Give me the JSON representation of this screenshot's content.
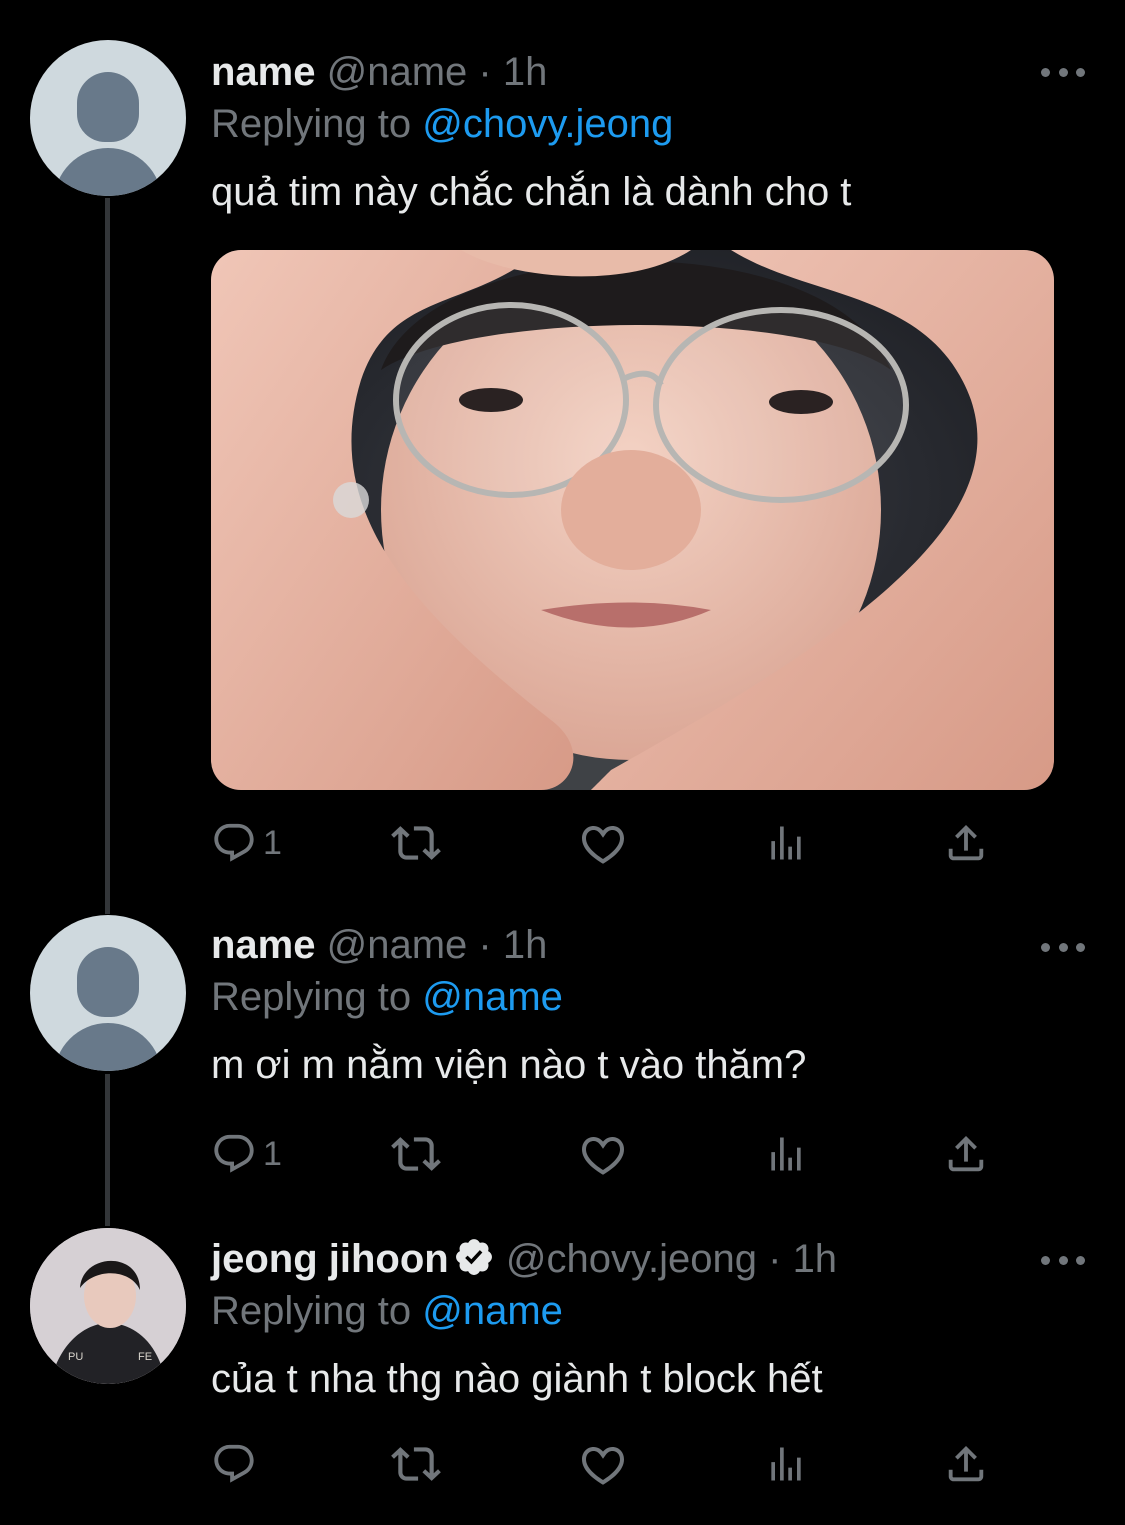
{
  "tweets": [
    {
      "display_name": "name",
      "handle": "@name",
      "separator": "·",
      "time": "1h",
      "reply_prefix": "Replying to",
      "reply_to": "@chovy.jeong",
      "text": "quả tim này chắc chắn là dành cho t",
      "has_media": true,
      "reply_count": "1",
      "verified": false
    },
    {
      "display_name": "name",
      "handle": "@name",
      "separator": "·",
      "time": "1h",
      "reply_prefix": "Replying to",
      "reply_to": "@name",
      "text": "m ơi m nằm viện nào t vào thăm?",
      "has_media": false,
      "reply_count": "1",
      "verified": false
    },
    {
      "display_name": "jeong jihoon",
      "handle": "@chovy.jeong",
      "separator": "·",
      "time": "1h",
      "reply_prefix": "Replying to",
      "reply_to": "@name",
      "text": "của t nha thg nào giành t block hết",
      "has_media": false,
      "reply_count": "",
      "verified": true
    }
  ],
  "icons": [
    "reply-icon",
    "retweet-icon",
    "like-icon",
    "views-icon",
    "share-icon",
    "more-icon",
    "verified-badge-icon"
  ],
  "colors": {
    "background": "#000000",
    "text_primary": "#e7e9ea",
    "text_secondary": "#71767b",
    "accent": "#1d9bf0",
    "thread_line": "#333639"
  }
}
